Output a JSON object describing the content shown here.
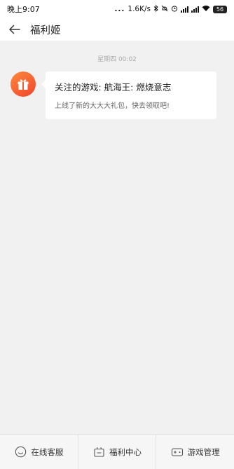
{
  "status_bar": {
    "time": "晚上9:07",
    "dots": "...",
    "net_speed": "1.6K/s",
    "battery": "56"
  },
  "header": {
    "title": "福利姬"
  },
  "chat": {
    "timestamp": "星期四 00:02",
    "message": {
      "title": "关注的游戏: 航海王: 燃烧意志",
      "body": "上线了新的大大大礼包，快去领取吧!"
    },
    "avatar_icon": "gift-icon",
    "avatar_colors": [
      "#ff8a3d",
      "#f0432b"
    ]
  },
  "bottom_tabs": [
    {
      "label": "在线客服",
      "icon": "smiley-icon"
    },
    {
      "label": "福利中心",
      "icon": "gift-box-outline-icon"
    },
    {
      "label": "游戏管理",
      "icon": "gamepad-icon"
    }
  ]
}
